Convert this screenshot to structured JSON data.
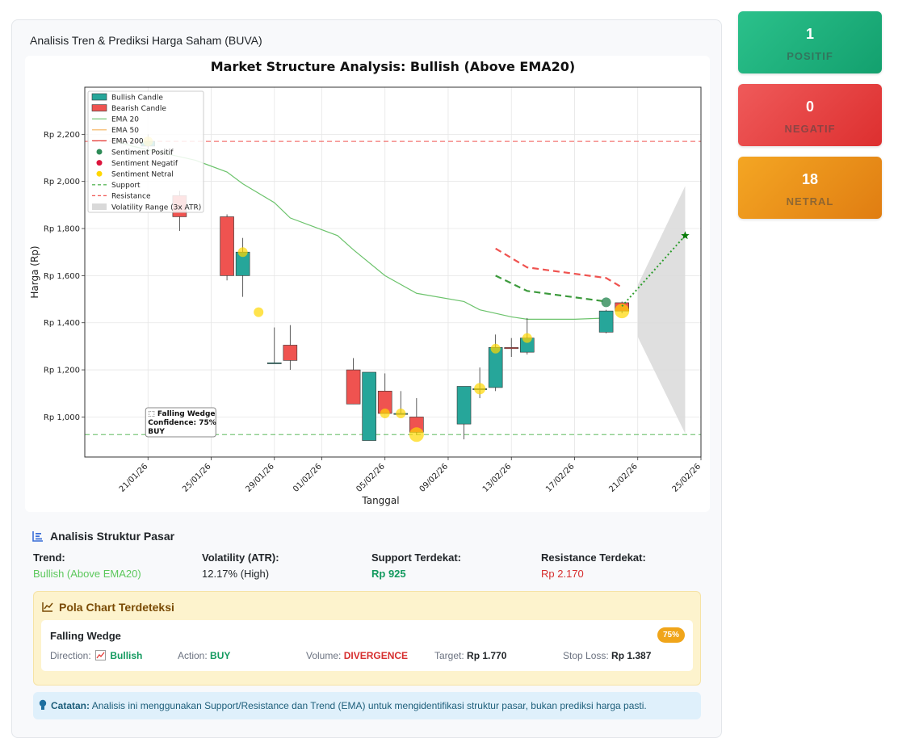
{
  "card_title": "Analisis Tren & Prediksi Harga Saham (BUVA)",
  "stats": [
    {
      "value": "1",
      "label": "POSITIF",
      "color": "#1db37f"
    },
    {
      "value": "0",
      "label": "NEGATIF",
      "color": "#e53e3e"
    },
    {
      "value": "18",
      "label": "NETRAL",
      "color": "#ec921b"
    }
  ],
  "chart_data": {
    "type": "candlestick",
    "title": "Market Structure Analysis: Bullish (Above EMA20)",
    "xlabel": "Tanggal",
    "ylabel": "Harga (Rp)",
    "ylim": [
      830,
      2400
    ],
    "yticks": [
      1000,
      1200,
      1400,
      1600,
      1800,
      2000,
      2200
    ],
    "ytick_labels": [
      "Rp 1,000",
      "Rp 1,200",
      "Rp 1,400",
      "Rp 1,600",
      "Rp 1,800",
      "Rp 2,000",
      "Rp 2,200"
    ],
    "xlim": [
      "2026-01-17",
      "2026-02-25"
    ],
    "xticks": [
      "2026-01-21",
      "2026-01-25",
      "2026-01-29",
      "2026-02-01",
      "2026-02-05",
      "2026-02-09",
      "2026-02-13",
      "2026-02-17",
      "2026-02-21",
      "2026-02-25"
    ],
    "xtick_labels": [
      "21/01/26",
      "25/01/26",
      "29/01/26",
      "01/02/26",
      "05/02/26",
      "09/02/26",
      "13/02/26",
      "17/02/26",
      "21/02/26",
      "25/02/26"
    ],
    "grid": true,
    "legend_position": "top-left",
    "legend": [
      "Bullish Candle",
      "Bearish Candle",
      "EMA 20",
      "EMA 50",
      "EMA 200",
      "Sentiment Positif",
      "Sentiment Negatif",
      "Sentiment Netral",
      "Support",
      "Resistance",
      "Volatility Range (3x ATR)"
    ],
    "colors": {
      "bull": "#26a69a",
      "bear": "#ef5350",
      "ema20": "#6cc36c",
      "ema50": "#f5b25a",
      "ema200": "#e53935",
      "support": "#5cb85c",
      "resistance": "#ef5350",
      "volatility": "#d9d9d9",
      "positive": "#2e8b57",
      "negative": "#dc143c",
      "neutral": "#ffd700",
      "forecast": "#2e9e2e"
    },
    "candles": [
      {
        "date": "2026-01-21",
        "open": 2150,
        "high": 2200,
        "low": 2120,
        "close": 2170
      },
      {
        "date": "2026-01-23",
        "open": 1940,
        "high": 1960,
        "low": 1790,
        "close": 1850
      },
      {
        "date": "2026-01-26",
        "open": 1850,
        "high": 1860,
        "low": 1580,
        "close": 1600
      },
      {
        "date": "2026-01-27",
        "open": 1600,
        "high": 1760,
        "low": 1510,
        "close": 1700
      },
      {
        "date": "2026-01-29",
        "open": 1230,
        "high": 1380,
        "low": 1230,
        "close": 1230
      },
      {
        "date": "2026-01-30",
        "open": 1305,
        "high": 1390,
        "low": 1200,
        "close": 1240
      },
      {
        "date": "2026-02-03",
        "open": 1200,
        "high": 1250,
        "low": 1055,
        "close": 1055
      },
      {
        "date": "2026-02-04",
        "open": 900,
        "high": 1190,
        "low": 900,
        "close": 1190
      },
      {
        "date": "2026-02-05",
        "open": 1110,
        "high": 1185,
        "low": 1015,
        "close": 1015
      },
      {
        "date": "2026-02-06",
        "open": 1015,
        "high": 1110,
        "low": 1015,
        "close": 1015
      },
      {
        "date": "2026-02-07",
        "open": 1000,
        "high": 1080,
        "low": 925,
        "close": 935
      },
      {
        "date": "2026-02-10",
        "open": 970,
        "high": 1130,
        "low": 905,
        "close": 1130
      },
      {
        "date": "2026-02-11",
        "open": 1120,
        "high": 1210,
        "low": 1080,
        "close": 1120
      },
      {
        "date": "2026-02-12",
        "open": 1125,
        "high": 1350,
        "low": 1110,
        "close": 1295
      },
      {
        "date": "2026-02-13",
        "open": 1295,
        "high": 1335,
        "low": 1255,
        "close": 1290
      },
      {
        "date": "2026-02-14",
        "open": 1275,
        "high": 1420,
        "low": 1265,
        "close": 1335
      },
      {
        "date": "2026-02-19",
        "open": 1360,
        "high": 1455,
        "low": 1355,
        "close": 1450
      },
      {
        "date": "2026-02-20",
        "open": 1485,
        "high": 1490,
        "low": 1440,
        "close": 1450
      }
    ],
    "ema20": [
      {
        "date": "2026-01-19",
        "value": 2170
      },
      {
        "date": "2026-01-20",
        "value": 2150
      },
      {
        "date": "2026-01-22",
        "value": 2120
      },
      {
        "date": "2026-01-24",
        "value": 2090
      },
      {
        "date": "2026-01-26",
        "value": 2040
      },
      {
        "date": "2026-01-27",
        "value": 1990
      },
      {
        "date": "2026-01-29",
        "value": 1910
      },
      {
        "date": "2026-01-30",
        "value": 1845
      },
      {
        "date": "2026-02-02",
        "value": 1770
      },
      {
        "date": "2026-02-03",
        "value": 1710
      },
      {
        "date": "2026-02-05",
        "value": 1600
      },
      {
        "date": "2026-02-07",
        "value": 1525
      },
      {
        "date": "2026-02-10",
        "value": 1490
      },
      {
        "date": "2026-02-11",
        "value": 1455
      },
      {
        "date": "2026-02-13",
        "value": 1425
      },
      {
        "date": "2026-02-14",
        "value": 1415
      },
      {
        "date": "2026-02-17",
        "value": 1415
      },
      {
        "date": "2026-02-19",
        "value": 1420
      }
    ],
    "sentiment_neutral": [
      {
        "date": "2026-01-21",
        "value": 2170,
        "size": 6
      },
      {
        "date": "2026-01-27",
        "value": 1700,
        "size": 6
      },
      {
        "date": "2026-01-28",
        "value": 1445,
        "size": 6
      },
      {
        "date": "2026-02-05",
        "value": 1015,
        "size": 6
      },
      {
        "date": "2026-02-06",
        "value": 1015,
        "size": 6
      },
      {
        "date": "2026-02-07",
        "value": 925,
        "size": 9
      },
      {
        "date": "2026-02-11",
        "value": 1120,
        "size": 7
      },
      {
        "date": "2026-02-12",
        "value": 1290,
        "size": 6
      },
      {
        "date": "2026-02-14",
        "value": 1335,
        "size": 6
      },
      {
        "date": "2026-02-20",
        "value": 1450,
        "size": 9
      }
    ],
    "sentiment_positive": [
      {
        "date": "2026-02-19",
        "value": 1487,
        "size": 6
      }
    ],
    "support": 925,
    "resistance": 2170,
    "support_projection": [
      {
        "date": "2026-02-12",
        "value": 1600
      },
      {
        "date": "2026-02-14",
        "value": 1535
      },
      {
        "date": "2026-02-19",
        "value": 1490
      }
    ],
    "resistance_projection": [
      {
        "date": "2026-02-12",
        "value": 1715
      },
      {
        "date": "2026-02-14",
        "value": 1635
      },
      {
        "date": "2026-02-19",
        "value": 1590
      },
      {
        "date": "2026-02-20",
        "value": 1550
      }
    ],
    "forecast": [
      {
        "date": "2026-02-20",
        "value": 1470
      },
      {
        "date": "2026-02-24",
        "value": 1770
      }
    ],
    "volatility_band": [
      {
        "date": "2026-02-21",
        "low": 1340,
        "high": 1560
      },
      {
        "date": "2026-02-24",
        "low": 930,
        "high": 1980
      }
    ],
    "annotation": {
      "line1": "⬚ Falling Wedge",
      "line2": "Confidence: 75%",
      "line3": "BUY"
    }
  },
  "structure": {
    "title": "Analisis Struktur Pasar",
    "items": [
      {
        "key": "Trend:",
        "value": "Bullish (Above EMA20)",
        "color": "#5cc85c"
      },
      {
        "key": "Volatility (ATR):",
        "value": "12.17% (High)",
        "color": "#212529"
      },
      {
        "key": "Support Terdekat:",
        "value": "Rp 925",
        "color": "#139a5f"
      },
      {
        "key": "Resistance Terdekat:",
        "value": "Rp 2.170",
        "color": "#d62f2f"
      }
    ]
  },
  "pattern": {
    "section_title": "Pola Chart Terdeteksi",
    "name": "Falling Wedge",
    "confidence": "75%",
    "direction_label": "Direction:",
    "direction_value": "Bullish",
    "action_label": "Action:",
    "action_value": "BUY",
    "volume_label": "Volume:",
    "volume_value": "DIVERGENCE",
    "target_label": "Target:",
    "target_value": "Rp 1.770",
    "stoploss_label": "Stop Loss:",
    "stoploss_value": "Rp 1.387"
  },
  "note": {
    "label": "Catatan:",
    "text": "Analisis ini menggunakan Support/Resistance dan Trend (EMA) untuk mengidentifikasi struktur pasar, bukan prediksi harga pasti."
  }
}
